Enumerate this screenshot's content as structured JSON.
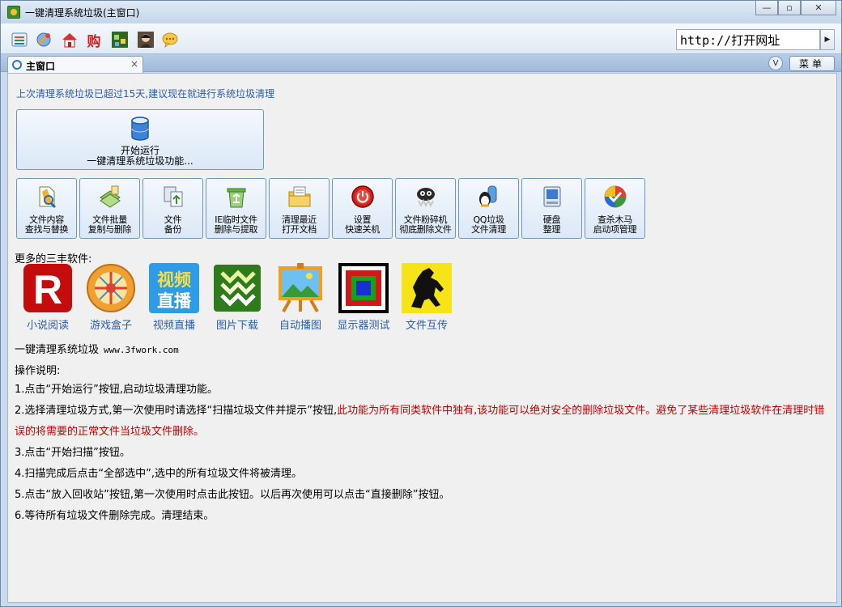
{
  "window": {
    "title": "一键清理系统垃圾(主窗口)",
    "controls": {
      "minimize": "—",
      "restore": "▫",
      "close": "✕"
    }
  },
  "toolbar": {
    "icons": [
      "settings-icon",
      "satellite-icon",
      "home-icon",
      "shop-icon",
      "game-icon",
      "avatar-icon",
      "chat-icon"
    ],
    "shop_label": "购",
    "url_value": "http://打开网址",
    "go_glyph": "▶"
  },
  "tabs": {
    "main_label": "主窗口",
    "close_glyph": "×",
    "dropdown_glyph": "V",
    "menu_label": "菜单"
  },
  "main": {
    "notice": "上次清理系统垃圾已超过15天,建议现在就进行系统垃圾清理",
    "start_button": {
      "line1": "开始运行",
      "line2": "一键清理系统垃圾功能..."
    },
    "tools": [
      {
        "line1": "文件内容",
        "line2": "查找与替换",
        "icon": "file-search-icon"
      },
      {
        "line1": "文件批量",
        "line2": "复制与删除",
        "icon": "file-batch-icon"
      },
      {
        "line1": "文件",
        "line2": "备份",
        "icon": "file-backup-icon"
      },
      {
        "line1": "IE临时文件",
        "line2": "删除与提取",
        "icon": "recycle-icon"
      },
      {
        "line1": "清理最近",
        "line2": "打开文档",
        "icon": "folder-icon"
      },
      {
        "line1": "设置",
        "line2": "快速关机",
        "icon": "power-icon"
      },
      {
        "line1": "文件粉碎机",
        "line2": "彻底删除文件",
        "icon": "shredder-icon"
      },
      {
        "line1": "QQ垃圾",
        "line2": "文件清理",
        "icon": "qq-icon"
      },
      {
        "line1": "硬盘",
        "line2": "整理",
        "icon": "disk-icon"
      },
      {
        "line1": "查杀木马",
        "line2": "启动项管理",
        "icon": "shield-icon"
      }
    ],
    "more_label": "更多的三丰软件:",
    "apps": [
      {
        "name": "小说阅读",
        "icon": "reader-icon",
        "logo_text": "R"
      },
      {
        "name": "游戏盒子",
        "icon": "game-box-icon",
        "logo_text": ""
      },
      {
        "name": "视频直播",
        "icon": "video-live-icon",
        "logo_text": "视频",
        "logo_text2": "直播"
      },
      {
        "name": "图片下载",
        "icon": "image-download-icon",
        "logo_text": ""
      },
      {
        "name": "自动播图",
        "icon": "slideshow-icon",
        "logo_text": ""
      },
      {
        "name": "显示器测试",
        "icon": "monitor-test-icon",
        "logo_text": ""
      },
      {
        "name": "文件互传",
        "icon": "horse-icon",
        "logo_text": ""
      }
    ],
    "brand_name": "一键清理系统垃圾",
    "brand_url": "www.3fwork.com",
    "instructions_title": "操作说明:",
    "steps": [
      {
        "text": "1.点击“开始运行”按钮,启动垃圾清理功能。"
      },
      {
        "text": "2.选择清理垃圾方式,第一次使用时请选择“扫描垃圾文件并提示”按钮,",
        "red": "此功能为所有同类软件中独有,该功能可以绝对安全的删除垃圾文件。避免了某些清理垃圾软件在清理时错误的将需要的正常文件当垃圾文件删除。"
      },
      {
        "text": "3.点击“开始扫描”按钮。"
      },
      {
        "text": "4.扫描完成后点击“全部选中”,选中的所有垃圾文件将被清理。"
      },
      {
        "text": "5.点击“放入回收站”按钮,第一次使用时点击此按钮。以后再次使用可以点击“直接删除”按钮。"
      },
      {
        "text": "6.等待所有垃圾文件删除完成。清理结束。"
      }
    ]
  },
  "colors": {
    "accent_blue": "#2a5ca8",
    "warning_red": "#c40000"
  }
}
